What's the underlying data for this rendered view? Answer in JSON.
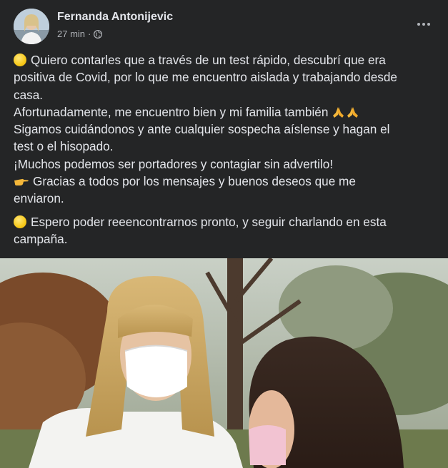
{
  "post": {
    "author": "Fernanda Antonijevic",
    "time": "27 min",
    "privacy_icon": "globe-icon",
    "menu_icon": "more-options-icon"
  },
  "content": {
    "line1": "Quiero contarles que a través de un test rápido, descubrí que era",
    "line2": "positiva de Covid, por lo que me encuentro aislada y trabajando desde",
    "line3": "casa.",
    "line4": "Afortunadamente, me encuentro bien y mi familia también",
    "line5": "Sigamos cuidándonos y ante cualquier sospecha aíslense y hagan el",
    "line6": "test o el hisopado.",
    "line7": "¡Muchos podemos ser portadores y contagiar sin advertilo!",
    "line8": "Gracias a todos por los mensajes y buenos deseos que me",
    "line9": "enviaron.",
    "line10": "Espero poder reeencontrarnos pronto, y seguir charlando en esta",
    "line11": "campaña."
  },
  "colors": {
    "card_bg": "#242526",
    "primary_text": "#e4e6eb",
    "secondary_text": "#b0b3b8"
  }
}
